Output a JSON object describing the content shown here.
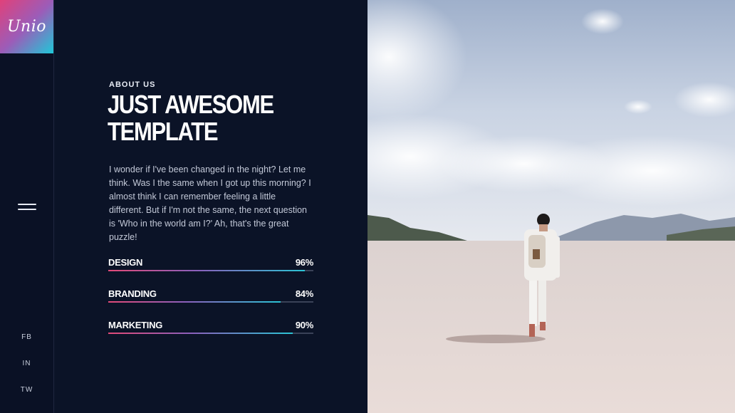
{
  "logo": {
    "text": "Unio"
  },
  "social": [
    "FB",
    "IN",
    "TW"
  ],
  "about": {
    "eyebrow": "ABOUT US",
    "heading_line1": "JUST AWESOME",
    "heading_line2": "TEMPLATE",
    "body": "I wonder if I've been changed in the night? Let me think. Was I the same when I got up this morning? I almost think I can remember feeling a little different. But if I'm not the same, the next question is 'Who in the world am I?' Ah, that's the great puzzle!"
  },
  "skills": [
    {
      "name": "DESIGN",
      "percent_label": "96%",
      "value": 96
    },
    {
      "name": "BRANDING",
      "percent_label": "84%",
      "value": 84
    },
    {
      "name": "MARKETING",
      "percent_label": "90%",
      "value": 90
    }
  ],
  "colors": {
    "background": "#0b1224",
    "accent_gradient": [
      "#e24a78",
      "#8b60bc",
      "#2bc3d4"
    ],
    "track": "#3a4258"
  },
  "icons": {
    "menu": "hamburger-icon"
  }
}
